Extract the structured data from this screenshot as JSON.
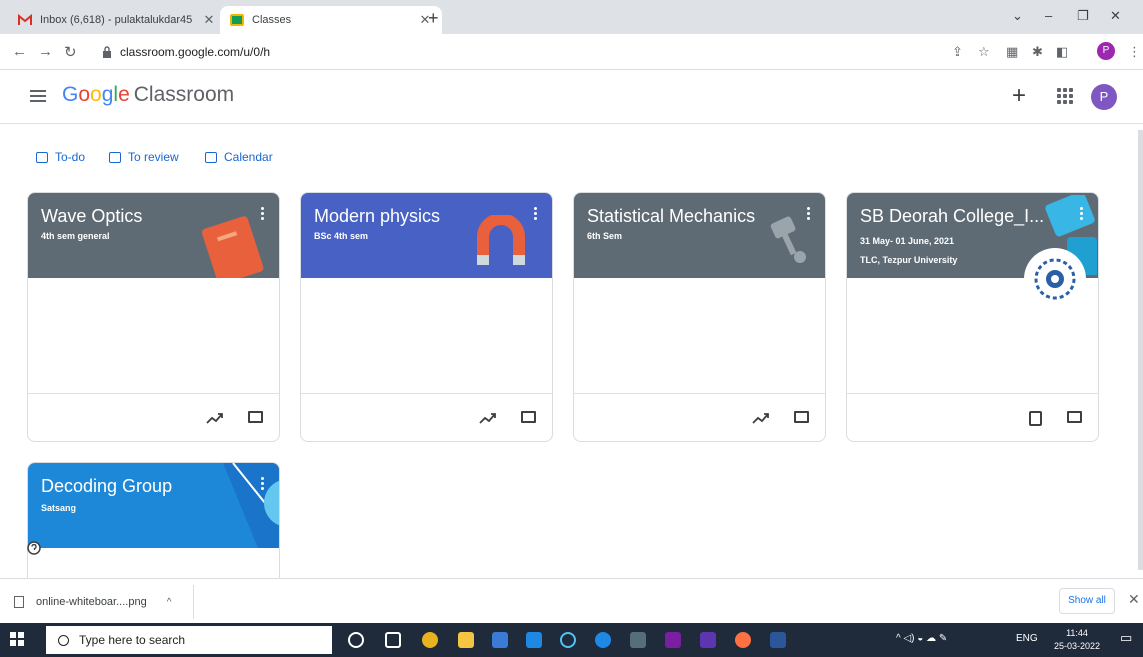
{
  "browser": {
    "tabs": [
      {
        "title": "Inbox (6,618) - pulaktalukdar45",
        "active": false
      },
      {
        "title": "Classes",
        "active": true
      }
    ],
    "url": "classroom.google.com/u/0/h",
    "profile_initial": "P"
  },
  "header": {
    "logo_google": [
      "G",
      "o",
      "o",
      "g",
      "l",
      "e"
    ],
    "logo_product": "Classroom",
    "avatar_initial": "P"
  },
  "quick_links": [
    {
      "label": "To-do"
    },
    {
      "label": "To review"
    },
    {
      "label": "Calendar"
    }
  ],
  "classes": [
    {
      "title": "Wave Optics",
      "subtitle": "4th sem general",
      "subtitle2": "",
      "color": "#5f6b74",
      "accent": "#e8613c",
      "footer": "trend"
    },
    {
      "title": "Modern physics",
      "subtitle": "BSc 4th sem",
      "subtitle2": "",
      "color": "#4762c4",
      "accent": "#e8613c",
      "footer": "trend"
    },
    {
      "title": "Statistical Mechanics",
      "subtitle": "6th Sem",
      "subtitle2": "",
      "color": "#5f6b74",
      "accent": "#9aa4ab",
      "footer": "trend"
    },
    {
      "title": "SB Deorah College_I...",
      "subtitle": "31 May- 01 June, 2021",
      "subtitle2": "TLC, Tezpur University",
      "color": "#5f6b74",
      "accent": "#38b6e6",
      "footer": "portrait"
    },
    {
      "title": "Decoding Group",
      "subtitle": "Satsang",
      "subtitle2": "",
      "color": "#1e88d8",
      "accent": "#64c7f0",
      "footer": "none"
    }
  ],
  "download": {
    "filename": "online-whiteboar....png",
    "show_all": "Show all"
  },
  "taskbar": {
    "search_placeholder": "Type here to search",
    "lang": "ENG",
    "time": "11:44",
    "date": "25-03-2022"
  }
}
